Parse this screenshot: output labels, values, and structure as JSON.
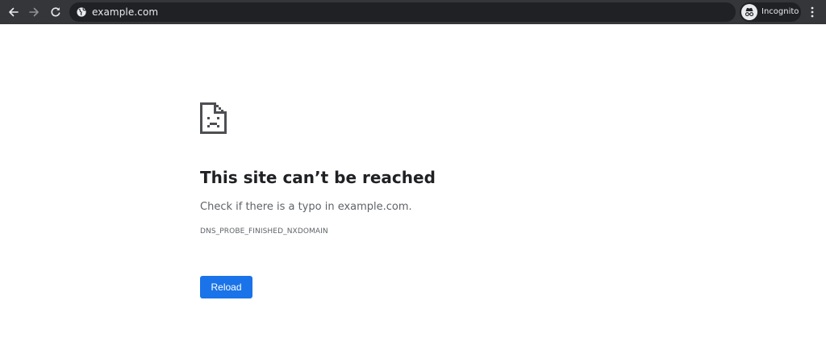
{
  "browser": {
    "url": "example.com",
    "profile_label": "Incognito",
    "icons": {
      "back": "back-arrow-icon",
      "forward": "forward-arrow-icon",
      "reload": "reload-icon",
      "site_info": "globe-icon",
      "incognito": "incognito-icon",
      "menu": "more-vertical-icon"
    },
    "colors": {
      "toolbar": "#35363a",
      "omnibox": "#202124",
      "text": "#e8eaed"
    }
  },
  "error_page": {
    "icon": "sad-page-icon",
    "title": "This site can’t be reached",
    "message": "Check if there is a typo in example.com.",
    "error_code": "DNS_PROBE_FINISHED_NXDOMAIN",
    "reload_label": "Reload",
    "colors": {
      "title": "#202124",
      "body_text": "#5f6368",
      "button": "#1a73e8"
    }
  }
}
